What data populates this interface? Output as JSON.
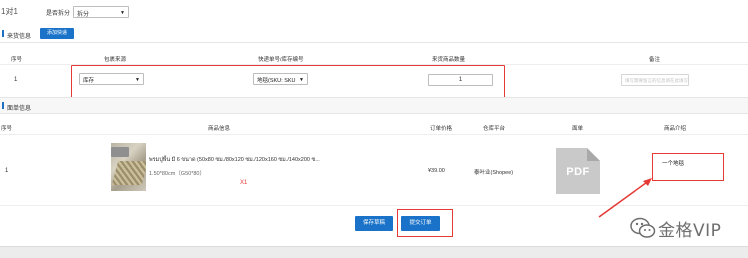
{
  "header": {
    "title": "1对1",
    "split_label": "是否拆分",
    "split_value": "拆分"
  },
  "express_section": {
    "title": "来货信息",
    "add_button": "添加快递",
    "columns": [
      "序号",
      "包裹来源",
      "快递单号/库存编号",
      "来货商品数量",
      "备注"
    ],
    "row": {
      "index": "1",
      "source_value": "库存",
      "tracking_value": "地毯(SKU: SKU",
      "quantity_value": "1",
      "remark_placeholder": "填写需要留言的信息请在此填写"
    }
  },
  "product_section": {
    "title": "面单信息",
    "columns": [
      "序号",
      "商品信息",
      "订单价格",
      "仓库平台",
      "面单",
      "商品介绍"
    ],
    "row": {
      "index": "1",
      "name": "พรมปูพื้น มี 6 ขนาด (50x80 ซม./80x120 ซม./120x160 ซม./140x200 ซ...",
      "spec": "1.50*80cm（G50*80）",
      "qty": "X1",
      "price": "¥39.00",
      "warehouse": "泰叶业(Shopee)",
      "file_label": "PDF",
      "intro": "一个地毯"
    }
  },
  "actions": {
    "save_draft": "保存草稿",
    "submit": "提交订单"
  },
  "watermark": {
    "text": "金格VIP"
  },
  "colors": {
    "primary": "#1a73c9",
    "highlight": "#e53935"
  }
}
